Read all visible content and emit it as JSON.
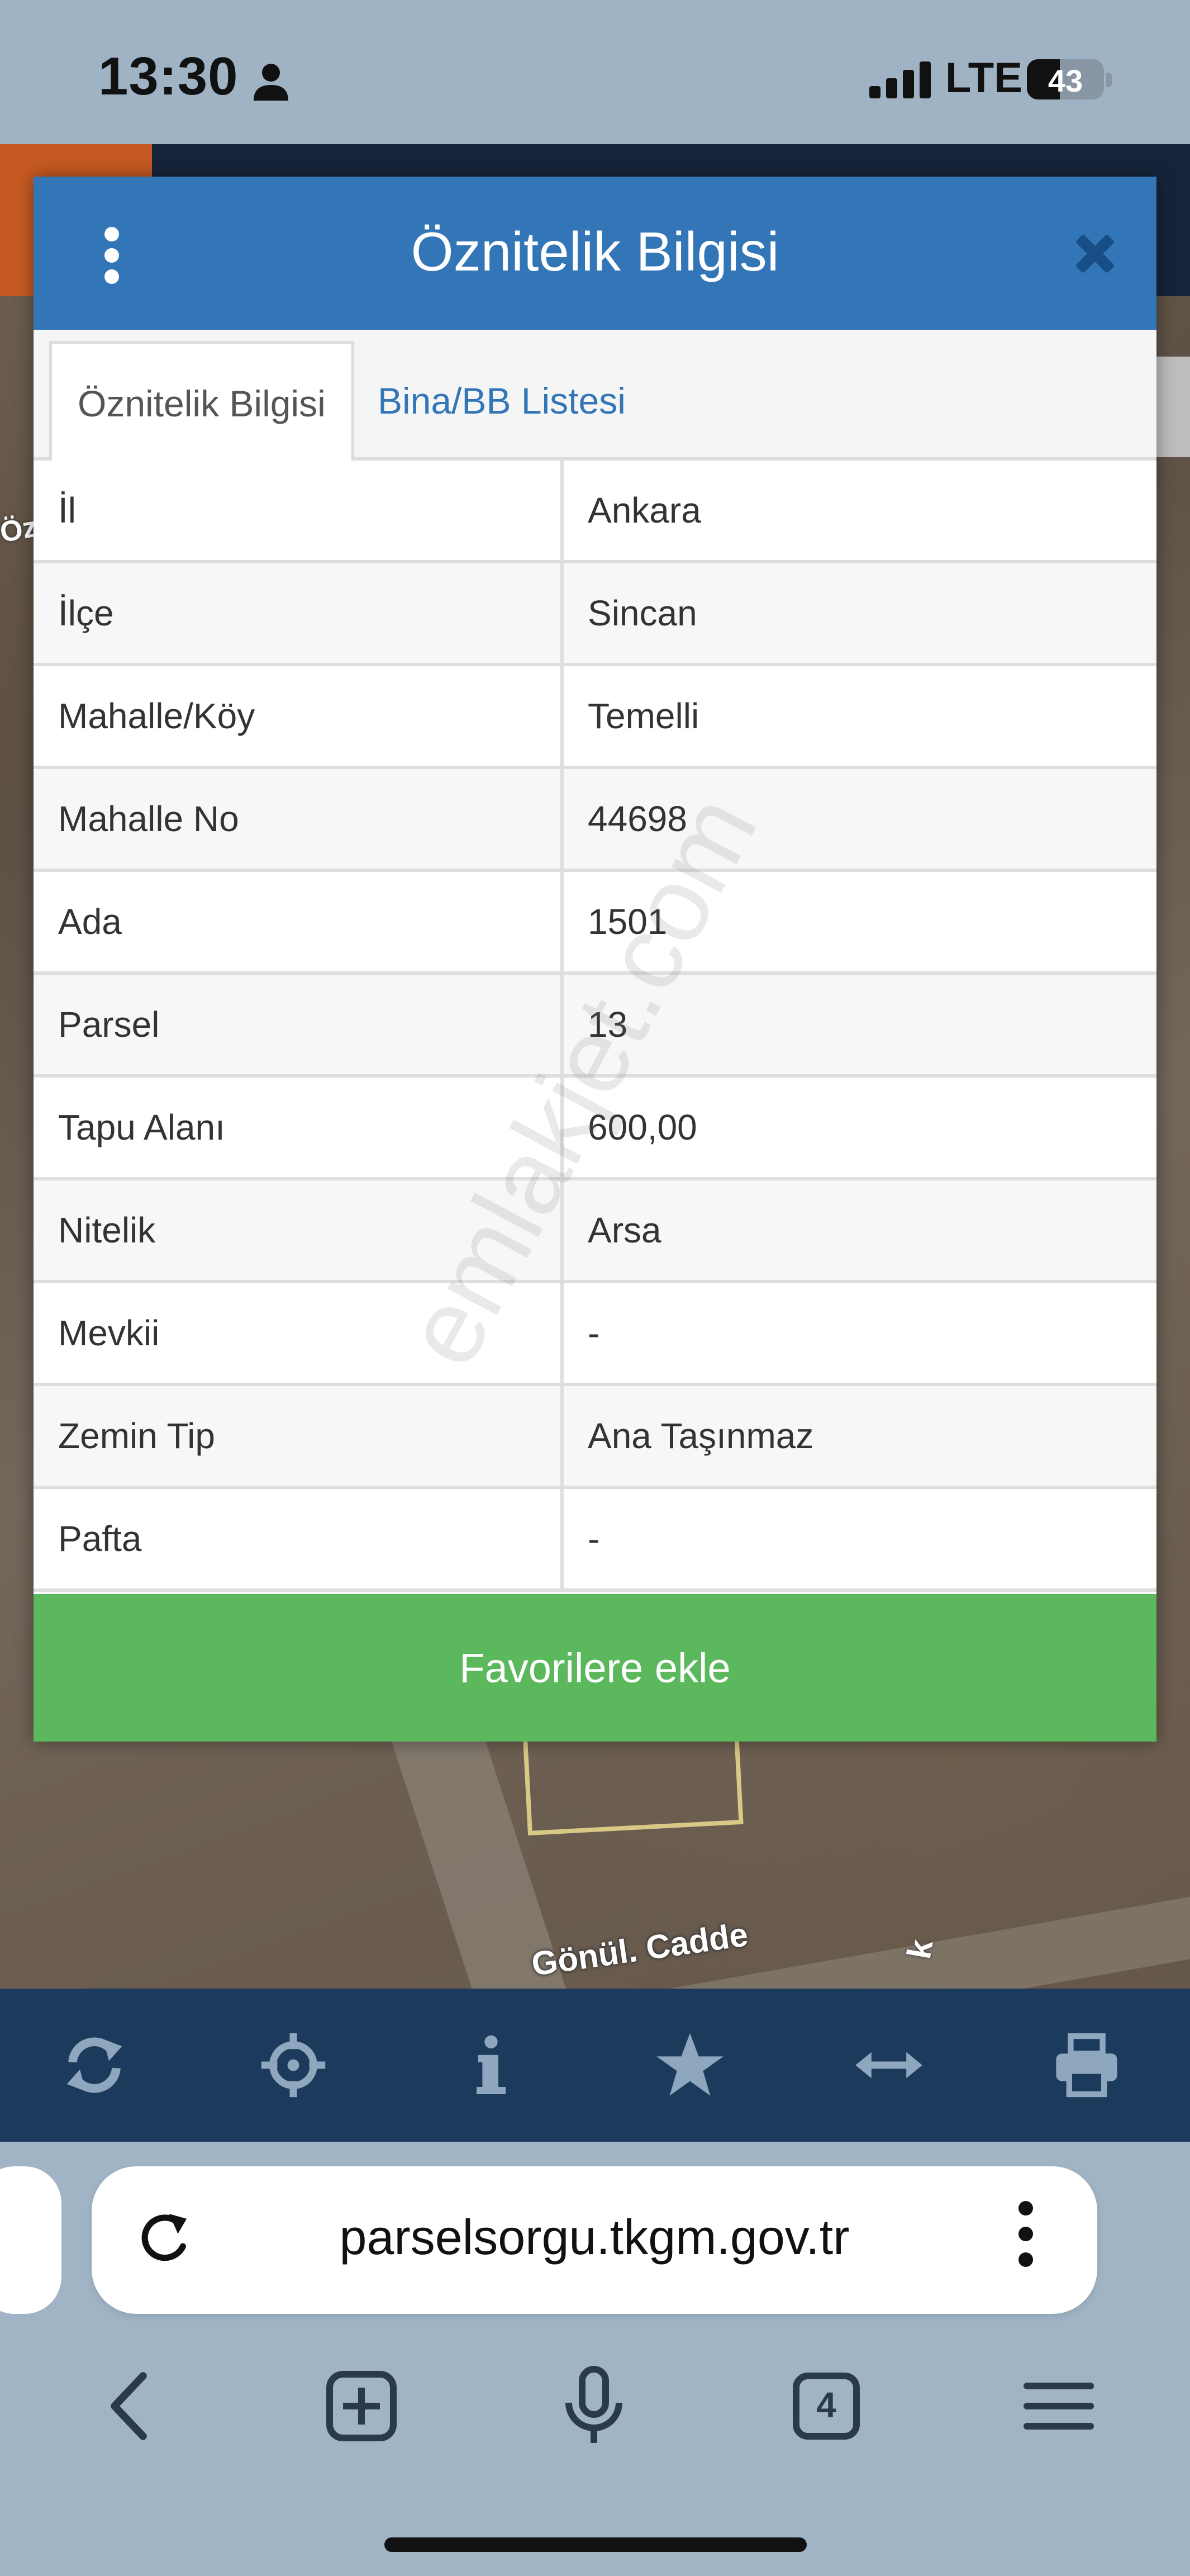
{
  "status_bar": {
    "time": "13:30",
    "network": "LTE",
    "battery": "43",
    "battery_level": 0.43
  },
  "map": {
    "street": "Gönül. Cadde",
    "street_fragment": "k",
    "left_fragment": "Öz"
  },
  "dialog": {
    "title": "Öznitelik Bilgisi",
    "tabs": [
      {
        "label": "Öznitelik Bilgisi"
      },
      {
        "label": "Bina/BB Listesi"
      }
    ],
    "rows": [
      {
        "key": "İl",
        "value": "Ankara"
      },
      {
        "key": "İlçe",
        "value": "Sincan"
      },
      {
        "key": "Mahalle/Köy",
        "value": "Temelli"
      },
      {
        "key": "Mahalle No",
        "value": "44698"
      },
      {
        "key": "Ada",
        "value": "1501"
      },
      {
        "key": "Parsel",
        "value": "13"
      },
      {
        "key": "Tapu Alanı",
        "value": "600,00"
      },
      {
        "key": "Nitelik",
        "value": "Arsa"
      },
      {
        "key": "Mevkii",
        "value": "-"
      },
      {
        "key": "Zemin Tip",
        "value": "Ana Taşınmaz"
      },
      {
        "key": "Pafta",
        "value": "-"
      }
    ],
    "favorite_label": "Favorilere ekle",
    "watermark": "emlakjet.com"
  },
  "toolbar": {
    "icons": [
      "refresh-icon",
      "crosshair-icon",
      "info-icon",
      "star-icon",
      "measure-icon",
      "print-icon"
    ]
  },
  "browser": {
    "url": "parselsorgu.tkgm.gov.tr",
    "tab_count": "4"
  },
  "colors": {
    "header": "#3276b7",
    "tab_link": "#3276b7",
    "favorite": "#5cb85c",
    "toolbar": "#1c3a5c"
  }
}
